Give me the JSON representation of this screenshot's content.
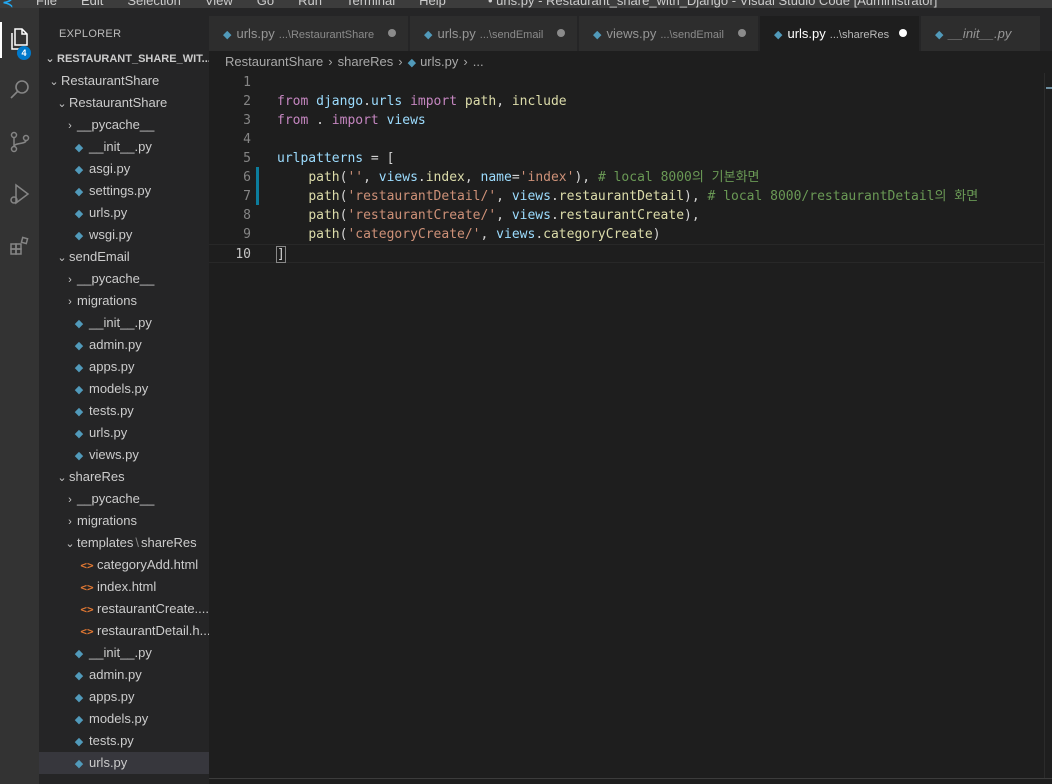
{
  "titlebar": {
    "menu": [
      "File",
      "Edit",
      "Selection",
      "View",
      "Go",
      "Run",
      "Terminal",
      "Help"
    ],
    "window_title": "• urls.py - Restaurant_share_with_Django - Visual Studio Code [Administrator]"
  },
  "activity_bar": {
    "explorer_badge": "4"
  },
  "sidebar": {
    "title": "EXPLORER",
    "root_folder": "RESTAURANT_SHARE_WIT...",
    "tree": [
      {
        "label": "RestaurantShare",
        "kind": "folder",
        "depth": 0,
        "expanded": true
      },
      {
        "label": "RestaurantShare",
        "kind": "folder",
        "depth": 1,
        "expanded": true
      },
      {
        "label": "__pycache__",
        "kind": "folder",
        "depth": 2,
        "expanded": false
      },
      {
        "label": "__init__.py",
        "kind": "py",
        "depth": 2
      },
      {
        "label": "asgi.py",
        "kind": "py",
        "depth": 2
      },
      {
        "label": "settings.py",
        "kind": "py",
        "depth": 2
      },
      {
        "label": "urls.py",
        "kind": "py",
        "depth": 2
      },
      {
        "label": "wsgi.py",
        "kind": "py",
        "depth": 2
      },
      {
        "label": "sendEmail",
        "kind": "folder",
        "depth": 1,
        "expanded": true
      },
      {
        "label": "__pycache__",
        "kind": "folder",
        "depth": 2,
        "expanded": false
      },
      {
        "label": "migrations",
        "kind": "folder",
        "depth": 2,
        "expanded": false
      },
      {
        "label": "__init__.py",
        "kind": "py",
        "depth": 2
      },
      {
        "label": "admin.py",
        "kind": "py",
        "depth": 2
      },
      {
        "label": "apps.py",
        "kind": "py",
        "depth": 2
      },
      {
        "label": "models.py",
        "kind": "py",
        "depth": 2
      },
      {
        "label": "tests.py",
        "kind": "py",
        "depth": 2
      },
      {
        "label": "urls.py",
        "kind": "py",
        "depth": 2
      },
      {
        "label": "views.py",
        "kind": "py",
        "depth": 2
      },
      {
        "label": "shareRes",
        "kind": "folder",
        "depth": 1,
        "expanded": true
      },
      {
        "label": "__pycache__",
        "kind": "folder",
        "depth": 2,
        "expanded": false
      },
      {
        "label": "migrations",
        "kind": "folder",
        "depth": 2,
        "expanded": false
      },
      {
        "label": "templates",
        "label2": "shareRes",
        "kind": "folder",
        "depth": 2,
        "expanded": true
      },
      {
        "label": "categoryAdd.html",
        "kind": "html",
        "depth": 3
      },
      {
        "label": "index.html",
        "kind": "html",
        "depth": 3
      },
      {
        "label": "restaurantCreate....",
        "kind": "html",
        "depth": 3
      },
      {
        "label": "restaurantDetail.h...",
        "kind": "html",
        "depth": 3
      },
      {
        "label": "__init__.py",
        "kind": "py",
        "depth": 2
      },
      {
        "label": "admin.py",
        "kind": "py",
        "depth": 2
      },
      {
        "label": "apps.py",
        "kind": "py",
        "depth": 2
      },
      {
        "label": "models.py",
        "kind": "py",
        "depth": 2
      },
      {
        "label": "tests.py",
        "kind": "py",
        "depth": 2
      },
      {
        "label": "urls.py",
        "kind": "py",
        "depth": 2,
        "selected": true
      }
    ]
  },
  "tabs": [
    {
      "name": "urls.py",
      "desc": "...\\RestaurantShare",
      "dirty": true,
      "active": false
    },
    {
      "name": "urls.py",
      "desc": "...\\sendEmail",
      "dirty": true,
      "active": false
    },
    {
      "name": "views.py",
      "desc": "...\\sendEmail",
      "dirty": true,
      "active": false
    },
    {
      "name": "urls.py",
      "desc": "...\\shareRes",
      "dirty": true,
      "active": true
    },
    {
      "name": "__init__.py",
      "desc": "",
      "dirty": false,
      "active": false,
      "italic": true
    }
  ],
  "breadcrumb": {
    "parts": [
      "RestaurantShare",
      "shareRes",
      "urls.py",
      "..."
    ]
  },
  "editor": {
    "current_line": 10,
    "lines": [
      {
        "n": "1",
        "tokens": []
      },
      {
        "n": "2",
        "tokens": [
          [
            "kw",
            "from"
          ],
          [
            "op",
            " "
          ],
          [
            "var",
            "django"
          ],
          [
            "op",
            "."
          ],
          [
            "var",
            "urls"
          ],
          [
            "op",
            " "
          ],
          [
            "kw",
            "import"
          ],
          [
            "op",
            " "
          ],
          [
            "fn",
            "path"
          ],
          [
            "op",
            ", "
          ],
          [
            "fn",
            "include"
          ]
        ]
      },
      {
        "n": "3",
        "tokens": [
          [
            "kw",
            "from"
          ],
          [
            "op",
            " . "
          ],
          [
            "kw",
            "import"
          ],
          [
            "op",
            " "
          ],
          [
            "var",
            "views"
          ]
        ]
      },
      {
        "n": "4",
        "tokens": []
      },
      {
        "n": "5",
        "tokens": [
          [
            "var",
            "urlpatterns"
          ],
          [
            "op",
            " = ["
          ]
        ]
      },
      {
        "n": "6",
        "tokens": [
          [
            "op",
            "    "
          ],
          [
            "fn",
            "path"
          ],
          [
            "op",
            "("
          ],
          [
            "str",
            "''"
          ],
          [
            "op",
            ", "
          ],
          [
            "var",
            "views"
          ],
          [
            "op",
            "."
          ],
          [
            "fn",
            "index"
          ],
          [
            "op",
            ", "
          ],
          [
            "var",
            "name"
          ],
          [
            "op",
            "="
          ],
          [
            "str",
            "'index'"
          ],
          [
            "op",
            "), "
          ],
          [
            "cmt",
            "# local 8000의 기본화면"
          ]
        ]
      },
      {
        "n": "7",
        "tokens": [
          [
            "op",
            "    "
          ],
          [
            "fn",
            "path"
          ],
          [
            "op",
            "("
          ],
          [
            "str",
            "'restaurantDetail/'"
          ],
          [
            "op",
            ", "
          ],
          [
            "var",
            "views"
          ],
          [
            "op",
            "."
          ],
          [
            "fn",
            "restaurantDetail"
          ],
          [
            "op",
            "), "
          ],
          [
            "cmt",
            "# local 8000/restaurantDetail의 화면"
          ]
        ]
      },
      {
        "n": "8",
        "tokens": [
          [
            "op",
            "    "
          ],
          [
            "fn",
            "path"
          ],
          [
            "op",
            "("
          ],
          [
            "str",
            "'restaurantCreate/'"
          ],
          [
            "op",
            ", "
          ],
          [
            "var",
            "views"
          ],
          [
            "op",
            "."
          ],
          [
            "fn",
            "restaurantCreate"
          ],
          [
            "op",
            "),"
          ]
        ]
      },
      {
        "n": "9",
        "tokens": [
          [
            "op",
            "    "
          ],
          [
            "fn",
            "path"
          ],
          [
            "op",
            "("
          ],
          [
            "str",
            "'categoryCreate/'"
          ],
          [
            "op",
            ", "
          ],
          [
            "var",
            "views"
          ],
          [
            "op",
            "."
          ],
          [
            "fn",
            "categoryCreate"
          ],
          [
            "op",
            ")"
          ]
        ]
      },
      {
        "n": "10",
        "tokens": [
          [
            "op",
            "]"
          ]
        ]
      }
    ]
  }
}
